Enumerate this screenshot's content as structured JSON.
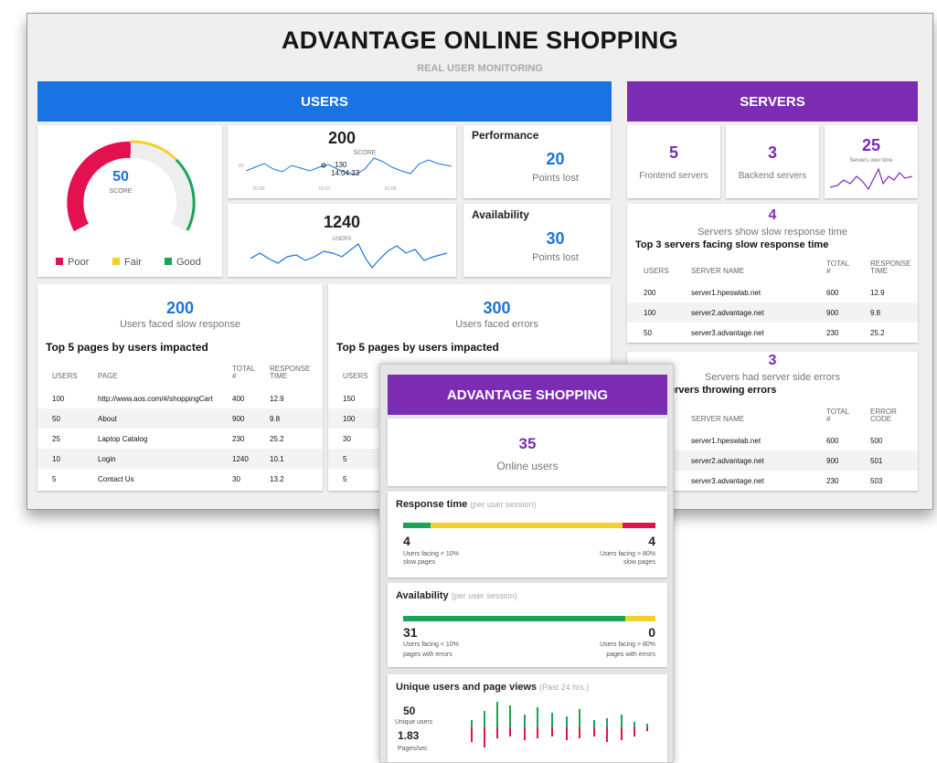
{
  "header": {
    "title": "ADVANTAGE ONLINE SHOPPING",
    "subtitle": "REAL USER MONITORING"
  },
  "users": {
    "bar_label": "USERS",
    "gauge": {
      "value": "50",
      "label": "SCORE",
      "legend": [
        "Poor",
        "Fair",
        "Good"
      ]
    },
    "score_chart": {
      "value": "200",
      "label": "SCORE",
      "tooltip_value": "130",
      "tooltip_time": "14:04:33",
      "y_tick": "50",
      "x_ticks": [
        "01:00",
        "01:57",
        "01:00"
      ]
    },
    "users_chart": {
      "value": "1240",
      "label": "USERS"
    },
    "performance": {
      "title": "Performance",
      "value": "20",
      "label": "Points lost"
    },
    "availability": {
      "title": "Availability",
      "value": "30",
      "label": "Points lost"
    },
    "slow": {
      "value": "200",
      "label": "Users faced slow response",
      "heading": "Top 5 pages by users impacted",
      "columns": [
        "USERS",
        "PAGE",
        "TOTAL #",
        "RESPONSE TIME"
      ],
      "rows": [
        [
          "100",
          "http://www.aos.com/#/shoppingCart",
          "400",
          "12.9"
        ],
        [
          "50",
          "About",
          "900",
          "9.8"
        ],
        [
          "25",
          "Laptop Catalog",
          "230",
          "25.2"
        ],
        [
          "10",
          "Login",
          "1240",
          "10.1"
        ],
        [
          "5",
          "Contact Us",
          "30",
          "13.2"
        ]
      ]
    },
    "errors": {
      "value": "300",
      "label": "Users faced errors",
      "heading": "Top 5 pages by users impacted",
      "columns": [
        "USERS"
      ],
      "rows": [
        [
          "150"
        ],
        [
          "100"
        ],
        [
          "30"
        ],
        [
          "5"
        ],
        [
          "5"
        ]
      ]
    }
  },
  "servers": {
    "bar_label": "SERVERS",
    "frontend": {
      "value": "5",
      "label": "Frontend servers"
    },
    "backend": {
      "value": "3",
      "label": "Backend servers"
    },
    "over_time": {
      "value": "25",
      "label": "Servers over time"
    },
    "slow": {
      "value": "4",
      "label": "Servers show slow response time",
      "heading": "Top 3 servers facing slow response time",
      "columns": [
        "USERS",
        "SERVER NAME",
        "TOTAL #",
        "RESPONSE TIME"
      ],
      "rows": [
        [
          "200",
          "server1.hpeswlab.net",
          "600",
          "12.9"
        ],
        [
          "100",
          "server2.advantage.net",
          "900",
          "9.8"
        ],
        [
          "50",
          "server3.advantage.net",
          "230",
          "25.2"
        ]
      ]
    },
    "errors": {
      "value": "3",
      "label": "Servers had server side errors",
      "heading": "ervers throwing errors",
      "columns": [
        "SERVER NAME",
        "TOTAL #",
        "ERROR CODE"
      ],
      "rows": [
        [
          "server1.hpeswlab.net",
          "600",
          "500"
        ],
        [
          "server2.advantage.net",
          "900",
          "501"
        ],
        [
          "server3.advantage.net",
          "230",
          "503"
        ]
      ]
    }
  },
  "mobile": {
    "title": "ADVANTAGE SHOPPING",
    "online": {
      "value": "35",
      "label": "Online users"
    },
    "response": {
      "title": "Response time",
      "qualifier": "(per user session)",
      "left_value": "4",
      "left_label_1": "Users facing < 10%",
      "left_label_2": "slow pages",
      "right_value": "4",
      "right_label_1": "Users facing > 80%",
      "right_label_2": "slow pages",
      "segments": [
        0.11,
        0.76,
        0.13
      ]
    },
    "availability": {
      "title": "Availability",
      "qualifier": "(per user session)",
      "left_value": "31",
      "left_label_1": "Users facing < 10%",
      "left_label_2": "pages with errors",
      "right_value": "0",
      "right_label_1": "Users facing > 80%",
      "right_label_2": "pages with errors",
      "segments": [
        0.88,
        0.12
      ]
    },
    "unique": {
      "title": "Unique users and page views",
      "qualifier": "(Past 24 hrs.)",
      "users_value": "50",
      "users_label": "Unique users",
      "pages_value": "1.83",
      "pages_label": "Pages/sec"
    }
  },
  "colors": {
    "blue": "#1a73d9",
    "purple": "#7b2cb3",
    "red": "#e3114f",
    "yellow": "#f3d128",
    "green": "#19a456"
  }
}
